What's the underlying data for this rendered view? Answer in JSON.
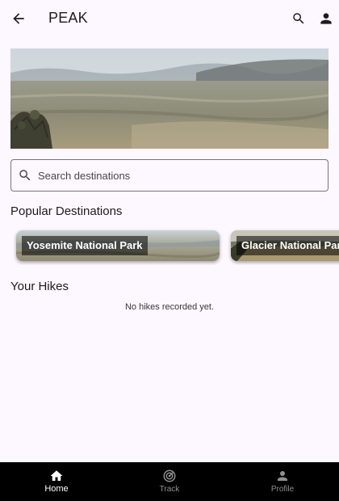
{
  "app_bar": {
    "title": "PEAK",
    "icons": [
      "arrow-back-icon",
      "search-icon",
      "person-icon"
    ]
  },
  "hero": {
    "description_icon": "landscape-photo"
  },
  "search": {
    "placeholder": "Search destinations",
    "value": ""
  },
  "popular": {
    "heading": "Popular Destinations",
    "items": [
      {
        "name": "Yosemite National Park"
      },
      {
        "name": "Glacier National Park"
      }
    ]
  },
  "hikes": {
    "heading": "Your Hikes",
    "empty_text": "No hikes recorded yet."
  },
  "bottom_nav": {
    "items": [
      {
        "label": "Home",
        "icon": "home-icon",
        "active": true
      },
      {
        "label": "Track",
        "icon": "track-icon",
        "active": false
      },
      {
        "label": "Profile",
        "icon": "profile-icon",
        "active": false
      }
    ]
  },
  "colors": {
    "background": "#fdf7ff",
    "nav_background": "#000000",
    "outline": "#79747e",
    "text": "#1d1b20"
  }
}
